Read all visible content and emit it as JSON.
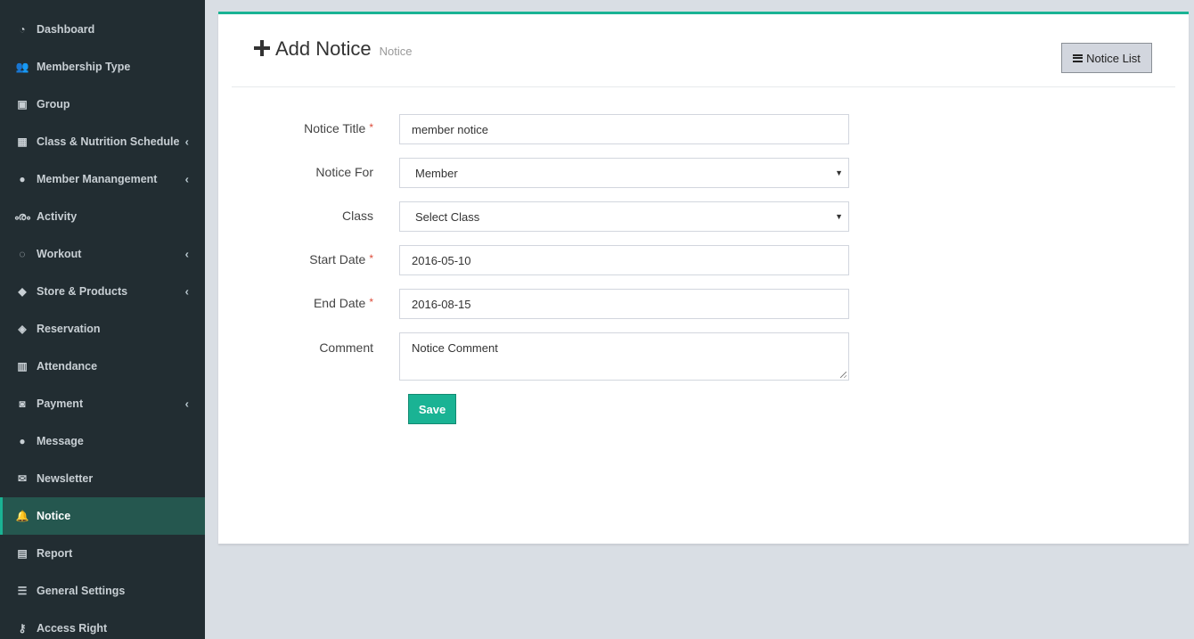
{
  "sidebar": {
    "items": [
      {
        "label": "Dashboard",
        "icon": "dashboard-icon",
        "glyph": "◔",
        "has_submenu": false,
        "active": false
      },
      {
        "label": "Membership Type",
        "icon": "users-icon",
        "glyph": "👥",
        "has_submenu": false,
        "active": false
      },
      {
        "label": "Group",
        "icon": "group-icon",
        "glyph": "▣",
        "has_submenu": false,
        "active": false
      },
      {
        "label": "Class & Nutrition Schedule",
        "icon": "calendar-icon",
        "glyph": "▦",
        "has_submenu": true,
        "active": false
      },
      {
        "label": "Member Manangement",
        "icon": "user-icon",
        "glyph": "●",
        "has_submenu": true,
        "active": false
      },
      {
        "label": "Activity",
        "icon": "bicycle-icon",
        "glyph": "ൟ",
        "has_submenu": false,
        "active": false
      },
      {
        "label": "Workout",
        "icon": "workout-icon",
        "glyph": "◌",
        "has_submenu": true,
        "active": false
      },
      {
        "label": "Store & Products",
        "icon": "tags-icon",
        "glyph": "◆",
        "has_submenu": true,
        "active": false
      },
      {
        "label": "Reservation",
        "icon": "ticket-icon",
        "glyph": "◈",
        "has_submenu": false,
        "active": false
      },
      {
        "label": "Attendance",
        "icon": "barcode-icon",
        "glyph": "▥",
        "has_submenu": false,
        "active": false
      },
      {
        "label": "Payment",
        "icon": "money-icon",
        "glyph": "◙",
        "has_submenu": true,
        "active": false
      },
      {
        "label": "Message",
        "icon": "comment-icon",
        "glyph": "●",
        "has_submenu": false,
        "active": false
      },
      {
        "label": "Newsletter",
        "icon": "envelope-icon",
        "glyph": "✉",
        "has_submenu": false,
        "active": false
      },
      {
        "label": "Notice",
        "icon": "bell-icon",
        "glyph": "🔔",
        "has_submenu": false,
        "active": true
      },
      {
        "label": "Report",
        "icon": "file-icon",
        "glyph": "▤",
        "has_submenu": false,
        "active": false
      },
      {
        "label": "General Settings",
        "icon": "sliders-icon",
        "glyph": "☰",
        "has_submenu": false,
        "active": false
      },
      {
        "label": "Access Right",
        "icon": "key-icon",
        "glyph": "⚷",
        "has_submenu": false,
        "active": false
      }
    ],
    "chevron": "‹"
  },
  "header": {
    "title": "Add Notice",
    "subtitle": "Notice",
    "list_button": "Notice List"
  },
  "form": {
    "notice_title": {
      "label": "Notice Title",
      "value": "member notice",
      "required": "*"
    },
    "notice_for": {
      "label": "Notice For",
      "value": "Member"
    },
    "class": {
      "label": "Class",
      "value": "Select Class"
    },
    "start_date": {
      "label": "Start Date",
      "value": "2016-05-10",
      "required": "*"
    },
    "end_date": {
      "label": "End Date",
      "value": "2016-08-15",
      "required": "*"
    },
    "comment": {
      "label": "Comment",
      "placeholder": "Notice Comment"
    },
    "save_label": "Save",
    "caret": "▼"
  },
  "colors": {
    "sidebar_bg": "#222d32",
    "accent": "#1ab394",
    "active_bg": "#25574f",
    "required": "#dd4b39"
  }
}
